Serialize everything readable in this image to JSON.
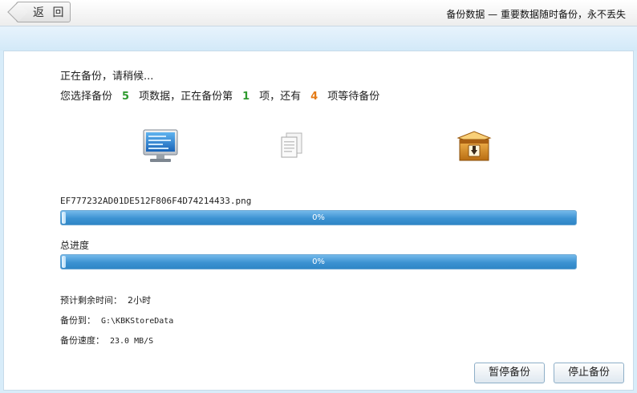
{
  "header": {
    "back_label": "返 回",
    "title": "备份数据 — 重要数据随时备份，永不丢失"
  },
  "status": {
    "line1": "正在备份，请稍候...",
    "prefix": "您选择备份",
    "total": "5",
    "mid1": "项数据，正在备份第",
    "current": "1",
    "mid2": "项，还有",
    "waiting": "4",
    "suffix": "项等待备份"
  },
  "icons": [
    "computer-monitor-icon",
    "document-copy-icon",
    "archive-box-icon"
  ],
  "current_file": {
    "name": "EF777232AD01DE512F806F4D74214433.png",
    "progress_percent": 0,
    "progress_label": "0%"
  },
  "overall": {
    "label": "总进度",
    "progress_percent": 0,
    "progress_label": "0%"
  },
  "info": {
    "remaining_label": "预计剩余时间：",
    "remaining_value": "2小时",
    "target_label": "备份到：",
    "target_value": "G:\\KBKStoreData",
    "speed_label": "备份速度：",
    "speed_value": "23.0 MB/S"
  },
  "buttons": {
    "pause": "暂停备份",
    "stop": "停止备份"
  },
  "colors": {
    "green": "#2e9a2e",
    "orange": "#e47a15",
    "progress_blue": "#3c92d2"
  }
}
